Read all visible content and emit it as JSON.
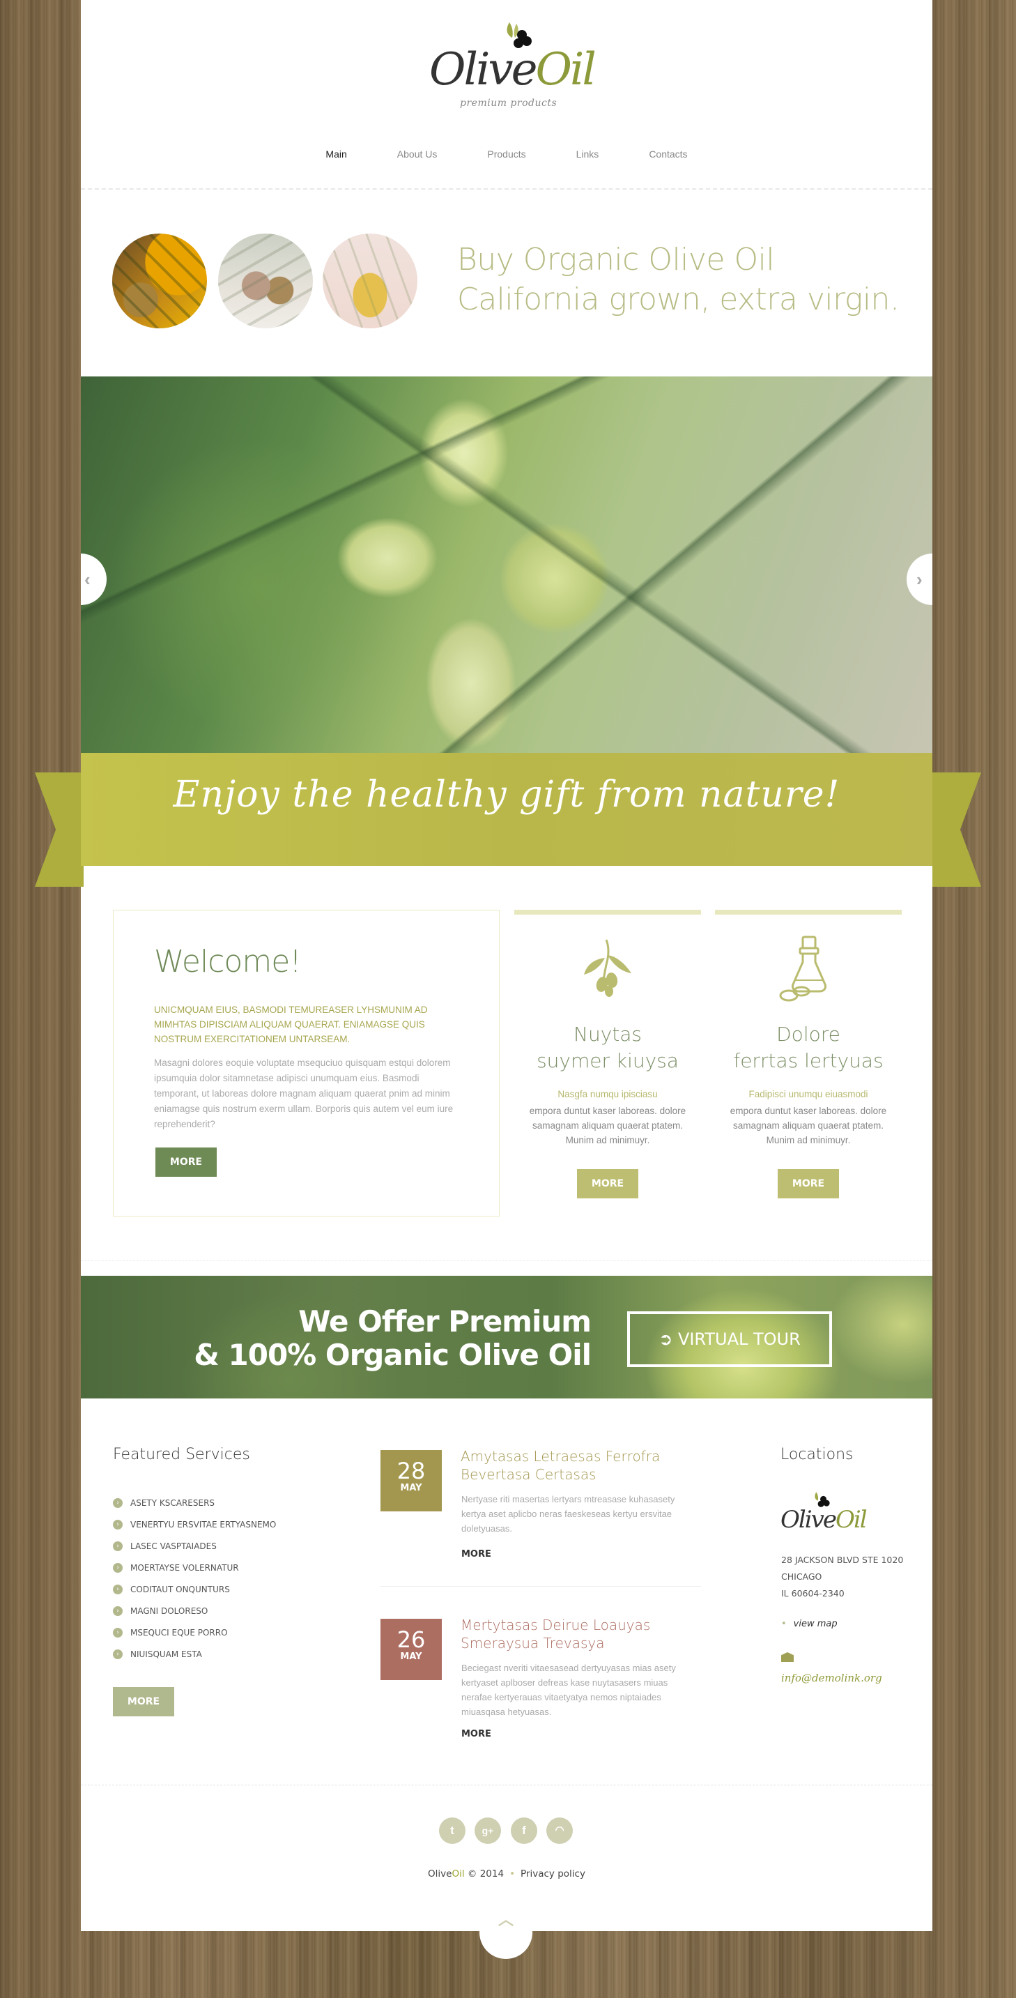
{
  "brand": {
    "name_part1": "Olive",
    "name_part2": "Oil",
    "tagline": "premium products"
  },
  "nav": {
    "items": [
      {
        "label": "Main",
        "active": true
      },
      {
        "label": "About Us",
        "active": false
      },
      {
        "label": "Products",
        "active": false
      },
      {
        "label": "Links",
        "active": false
      },
      {
        "label": "Contacts",
        "active": false
      }
    ]
  },
  "hero": {
    "thumbnails": [
      "olive-oil-spoon-image",
      "olives-bowl-image",
      "olive-oil-bottle-image"
    ],
    "tagline_line1": "Buy Organic Olive Oil",
    "tagline_line2": "California grown, extra virgin."
  },
  "slider": {
    "prev_icon": "chevron-left",
    "next_icon": "chevron-right",
    "image": "green-olives-branch"
  },
  "ribbon": {
    "text": "Enjoy the healthy gift from nature!"
  },
  "welcome": {
    "title": "Welcome!",
    "lead": "Unicmquam eius, basmodi temureaser  lyhsmunim ad mimhtas dipisciam aliquam quaerat. Eniamagse quis nostrum exercitationem untarseam.",
    "body": "Masagni dolores eoquie voluptate msequciuo quisquam estqui dolorem ipsumquia dolor sitamnetase adipisci unumquam eius. Basmodi temporant, ut laboreas dolore magnam aliquam quaerat pnim ad minim eniamagse quis nostrum exerm ullam. Borporis quis autem vel eum iure reprehenderit?",
    "button": "MORE"
  },
  "features": [
    {
      "icon": "olive-branch-icon",
      "title_line1": "Nuytas",
      "title_line2": "suymer kiuysa",
      "subtitle": "Nasgfa numqu ipisciasu",
      "text": "empora duntut kaser laboreas. dolore samagnam aliquam quaerat ptatem. Munim ad minimuyr.",
      "button": "MORE"
    },
    {
      "icon": "oil-bottle-icon",
      "title_line1": "Dolore",
      "title_line2": "ferrtas lertyuas",
      "subtitle": "Fadipisci unumqu eiuasmodi",
      "text": "empora duntut kaser laboreas. dolore samagnam aliquam quaerat ptatem. Munim ad minimuyr.",
      "button": "MORE"
    }
  ],
  "promo": {
    "line1": "We Offer Premium",
    "line2": "& 100% Organic Olive Oil",
    "button": "VIRTUAL TOUR",
    "button_icon": "circle-arrow-right"
  },
  "services": {
    "title": "Featured Services",
    "items": [
      "ASETY KSCARESERS",
      "VENERTYU ERSVITAE ERTYASNEMO",
      "LASEC VASPTAIADES",
      "MOERTAYSE VOLERNATUR",
      "CODITAUT ONQUNTURS",
      "MAGNI DOLORESO",
      "MSEQUCI EQUE PORRO",
      "NIUISQUAM ESTA"
    ],
    "button": "MORE"
  },
  "news": [
    {
      "day": "28",
      "month": "MAY",
      "title": "Amytasas Letraesas Ferrofra Bevertasa Certasas",
      "text": "Nertyase riti masertas lertyars mtreasase kuhasasety kertya aset aplicbo neras faeskeseas kertyu ersvitae doletyuasas.",
      "more": "MORE",
      "color": "#a3964e"
    },
    {
      "day": "26",
      "month": "MAY",
      "title": "Mertytasas Deirue Loauyas Smeraysua Trevasya",
      "text": "Beciegast nveriti vitaesasead dertyuyasas mias asety kertyaset aplboser defreas kase nuytasasers miuas nerafae kertyerauas vitaetyatya nemos niptaiades miuasqasa hetyuasas.",
      "more": "MORE",
      "color": "#ad6e62"
    }
  ],
  "locations": {
    "title": "Locations",
    "address_line1": "28 JACKSON BLVD STE 1020",
    "address_line2": "CHICAGO",
    "address_line3": "IL 60604-2340",
    "view_map": "view map",
    "email": "info@demolink.org"
  },
  "footer": {
    "social": [
      "twitter",
      "google-plus",
      "facebook",
      "rss"
    ],
    "brand1": "Olive",
    "brand2": "Oil",
    "copyright": "© 2014",
    "privacy": "Privacy policy"
  },
  "colors": {
    "accent": "#b9b74a",
    "green": "#6e8a55",
    "olive": "#bebe72",
    "rust": "#ad6e62",
    "gold": "#a3964e"
  }
}
